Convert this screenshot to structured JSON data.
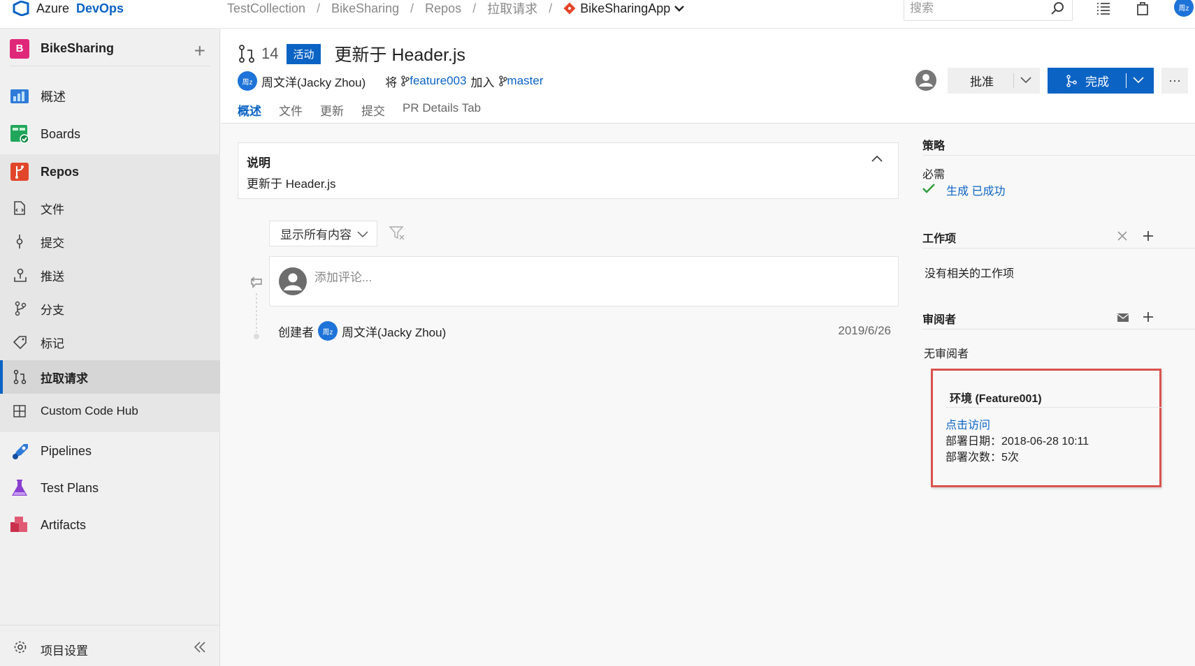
{
  "topbar": {
    "brand_azure": "Azure",
    "brand_devops": "DevOps",
    "breadcrumbs": [
      "TestCollection",
      "BikeSharing",
      "Repos",
      "拉取请求"
    ],
    "repo": "BikeSharingApp",
    "search_placeholder": "搜索",
    "user_initials": "周z"
  },
  "sidebar": {
    "project_initial": "B",
    "project_name": "BikeSharing",
    "items": [
      {
        "label": "概述",
        "icon": "overview-icon"
      },
      {
        "label": "Boards",
        "icon": "boards-icon"
      },
      {
        "label": "Repos",
        "icon": "repos-icon"
      },
      {
        "label": "文件",
        "icon": "files-icon"
      },
      {
        "label": "提交",
        "icon": "commits-icon"
      },
      {
        "label": "推送",
        "icon": "pushes-icon"
      },
      {
        "label": "分支",
        "icon": "branches-icon"
      },
      {
        "label": "标记",
        "icon": "tags-icon"
      },
      {
        "label": "拉取请求",
        "icon": "pull-request-icon"
      },
      {
        "label": "Custom Code Hub",
        "icon": "grid-icon"
      },
      {
        "label": "Pipelines",
        "icon": "pipelines-icon"
      },
      {
        "label": "Test Plans",
        "icon": "test-plans-icon"
      },
      {
        "label": "Artifacts",
        "icon": "artifacts-icon"
      }
    ],
    "settings_label": "项目设置"
  },
  "pr": {
    "number": "14",
    "status": "活动",
    "title": "更新于 Header.js",
    "author_initials": "周z",
    "author": "周文洋(Jacky Zhou)",
    "merge_prefix": "将",
    "source_branch": "feature003",
    "merge_into": "加入",
    "target_branch": "master",
    "tabs": [
      "概述",
      "文件",
      "更新",
      "提交",
      "PR Details Tab"
    ],
    "approve_label": "批准",
    "complete_label": "完成",
    "more_label": "···"
  },
  "description": {
    "heading": "说明",
    "text": "更新于 Header.js"
  },
  "activity": {
    "filter_label": "显示所有内容",
    "comment_placeholder": "添加评论...",
    "created_by_label": "创建者",
    "created_by_initials": "周z",
    "created_by": "周文洋(Jacky Zhou)",
    "created_date": "2019/6/26"
  },
  "panel": {
    "policies_heading": "策略",
    "required_label": "必需",
    "build_status": "生成 已成功",
    "work_items_heading": "工作项",
    "work_items_empty": "没有相关的工作项",
    "reviewers_heading": "审阅者",
    "reviewers_empty": "无审阅者",
    "env_heading": "环境 (Feature001)",
    "env_link": "点击访问",
    "env_deploy_date": "部署日期：2018-06-28 10:11",
    "env_deploy_count": "部署次数：5次"
  },
  "colors": {
    "accent": "#0b63c4",
    "highlight_border": "#d9534f",
    "success": "#2e9b3e"
  }
}
